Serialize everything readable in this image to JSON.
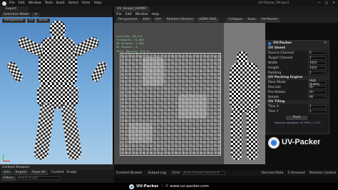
{
  "app": {
    "title": "UV-Packer_Ptroject",
    "menu": [
      "File",
      "Edit",
      "Window",
      "Tools",
      "Build",
      "Select",
      "Actor",
      "Help"
    ]
  },
  "tabs": {
    "project": "Export",
    "uv_asset": "UV_Sculpt_UVMAT"
  },
  "left_view": {
    "toolbar": [
      "Perspective",
      "Lit",
      "Show"
    ],
    "selection_mode": "Selection Mode"
  },
  "uv_toolbar": {
    "buttons": [
      "Perspective",
      "Edit",
      "Ctrl",
      "Shaded (Vertex)",
      "UDIM 1001"
    ]
  },
  "uv_stats": [
    "Vertices: 36,112",
    "Triangles: 71,804",
    "UV Islands: 1,284",
    "UV Channel: 0",
    "Texel Density: 512.0"
  ],
  "mid_toolbar": {
    "buttons": [
      "Collapse",
      "Auto",
      "UV-Packer"
    ]
  },
  "panel": {
    "title": "UV-Packer",
    "section1": "UV Sheet",
    "rows1": [
      {
        "label": "Source Channel",
        "value": "0"
      },
      {
        "label": "Target Channel",
        "value": "1"
      },
      {
        "label": "Width",
        "value": "1024"
      },
      {
        "label": "Height",
        "value": "1024"
      },
      {
        "label": "Padding",
        "value": "2"
      }
    ],
    "section2": "UV Packing Engine",
    "rows2": [
      {
        "label": "Pack Mode",
        "value": "High Quality"
      },
      {
        "label": "Rescale",
        "value": "On"
      },
      {
        "label": "Pre-Rotate",
        "value": "On"
      },
      {
        "label": "Rotate",
        "value": "90"
      }
    ],
    "section3": "UV Tiling",
    "rows3": [
      {
        "label": "Tiles X",
        "value": "1"
      },
      {
        "label": "Tiles Y",
        "value": "1"
      }
    ],
    "pack_button": "Pack",
    "status": "Packing complete: 97.59% | 1.17s"
  },
  "logo_text": "UV-Packer",
  "bottom_left": {
    "title": "Content Browser",
    "buttons": [
      "Add",
      "Import",
      "Save All",
      "Content",
      "Sculpt"
    ],
    "filters": "Filters",
    "search": "Search Sculpt"
  },
  "bottom_bar": {
    "items": [
      "Content Drawer",
      "Output Log",
      "Cmd",
      "Enter Console Command"
    ]
  },
  "status_right": [
    "Derived Data",
    "2 Unsaved",
    "Revision Control"
  ],
  "footer": {
    "brand": "UV-Packer",
    "url": "www.uv-packer.com"
  },
  "colors": {
    "accent": "#2f7be0",
    "panel_bg": "#1b1b1b",
    "uv_bg": "#8e8e8e",
    "sky": "#6fa6d8"
  }
}
